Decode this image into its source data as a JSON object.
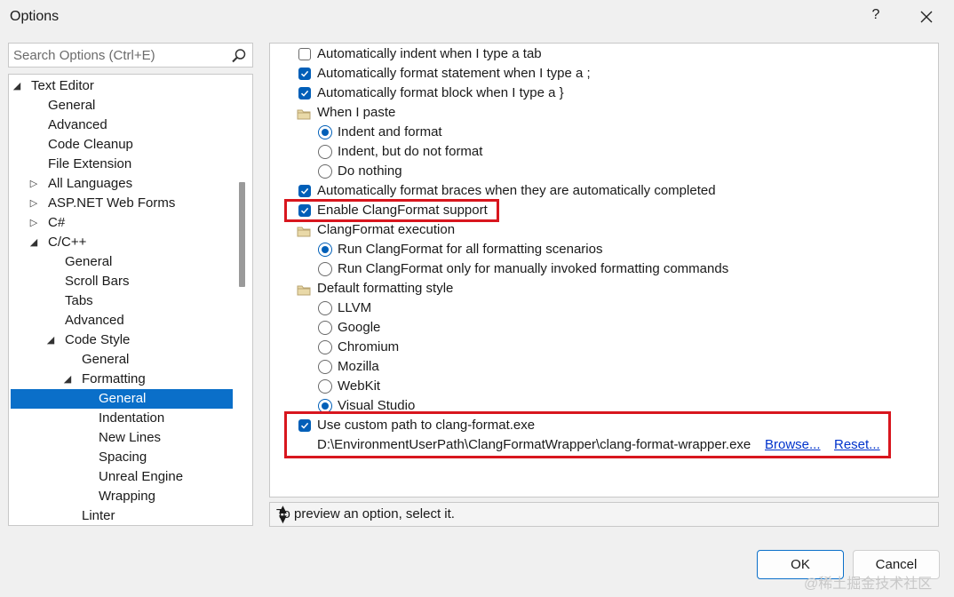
{
  "window": {
    "title": "Options",
    "help": "?"
  },
  "search": {
    "placeholder": "Search Options (Ctrl+E)"
  },
  "tree": [
    {
      "label": "Text Editor",
      "indent": 0,
      "arrow": "expanded"
    },
    {
      "label": "General",
      "indent": 1
    },
    {
      "label": "Advanced",
      "indent": 1
    },
    {
      "label": "Code Cleanup",
      "indent": 1
    },
    {
      "label": "File Extension",
      "indent": 1
    },
    {
      "label": "All Languages",
      "indent": 1,
      "arrow": "collapsed"
    },
    {
      "label": "ASP.NET Web Forms",
      "indent": 1,
      "arrow": "collapsed"
    },
    {
      "label": "C#",
      "indent": 1,
      "arrow": "collapsed"
    },
    {
      "label": "C/C++",
      "indent": 1,
      "arrow": "expanded"
    },
    {
      "label": "General",
      "indent": 2
    },
    {
      "label": "Scroll Bars",
      "indent": 2
    },
    {
      "label": "Tabs",
      "indent": 2
    },
    {
      "label": "Advanced",
      "indent": 2
    },
    {
      "label": "Code Style",
      "indent": 2,
      "arrow": "expanded"
    },
    {
      "label": "General",
      "indent": 3
    },
    {
      "label": "Formatting",
      "indent": 3,
      "arrow": "expanded"
    },
    {
      "label": "General",
      "indent": 4,
      "selected": true
    },
    {
      "label": "Indentation",
      "indent": 4
    },
    {
      "label": "New Lines",
      "indent": 4
    },
    {
      "label": "Spacing",
      "indent": 4
    },
    {
      "label": "Unreal Engine",
      "indent": 4
    },
    {
      "label": "Wrapping",
      "indent": 4
    },
    {
      "label": "Linter",
      "indent": 3
    }
  ],
  "options": [
    {
      "type": "checkbox",
      "label": "Automatically indent when I type a tab",
      "checked": false,
      "level": 0
    },
    {
      "type": "checkbox",
      "label": "Automatically format statement when I type a ;",
      "checked": true,
      "level": 0
    },
    {
      "type": "checkbox",
      "label": "Automatically format block when I type a }",
      "checked": true,
      "level": 0
    },
    {
      "type": "group",
      "label": "When I paste",
      "icon": "folder-icon",
      "level": 0
    },
    {
      "type": "radio",
      "label": "Indent and format",
      "checked": true,
      "level": 1
    },
    {
      "type": "radio",
      "label": "Indent, but do not format",
      "checked": false,
      "level": 1
    },
    {
      "type": "radio",
      "label": "Do nothing",
      "checked": false,
      "level": 1
    },
    {
      "type": "checkbox",
      "label": "Automatically format braces when they are automatically completed",
      "checked": true,
      "level": 0
    },
    {
      "type": "checkbox",
      "label": "Enable ClangFormat support",
      "checked": true,
      "level": 0
    },
    {
      "type": "group",
      "label": "ClangFormat execution",
      "icon": "folder-icon",
      "level": 0
    },
    {
      "type": "radio",
      "label": "Run ClangFormat for all formatting scenarios",
      "checked": true,
      "level": 1
    },
    {
      "type": "radio",
      "label": "Run ClangFormat only for manually invoked formatting commands",
      "checked": false,
      "level": 1
    },
    {
      "type": "group",
      "label": "Default formatting style",
      "icon": "folder-icon",
      "level": 0
    },
    {
      "type": "radio",
      "label": "LLVM",
      "checked": false,
      "level": 1
    },
    {
      "type": "radio",
      "label": "Google",
      "checked": false,
      "level": 1
    },
    {
      "type": "radio",
      "label": "Chromium",
      "checked": false,
      "level": 1
    },
    {
      "type": "radio",
      "label": "Mozilla",
      "checked": false,
      "level": 1
    },
    {
      "type": "radio",
      "label": "WebKit",
      "checked": false,
      "level": 1
    },
    {
      "type": "radio",
      "label": "Visual Studio",
      "checked": true,
      "level": 1
    },
    {
      "type": "checkbox",
      "label": "Use custom path to clang-format.exe",
      "checked": true,
      "level": 0
    }
  ],
  "custom_path": {
    "path": "D:\\EnvironmentUserPath\\ClangFormatWrapper\\clang-format-wrapper.exe",
    "browse": "Browse...",
    "reset": "Reset..."
  },
  "status": {
    "text": "To preview an option, select it."
  },
  "buttons": {
    "ok": "OK",
    "cancel": "Cancel"
  },
  "watermark": "@稀土掘金技术社区",
  "colors": {
    "accent": "#005fb8",
    "selection": "#0a6fc9",
    "highlight": "#d8161e",
    "link": "#0033cc"
  }
}
